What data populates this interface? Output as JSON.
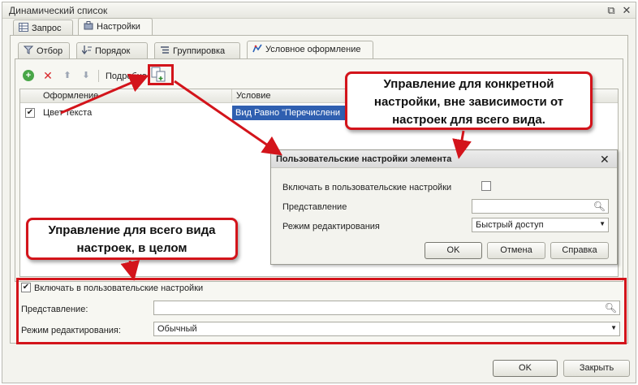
{
  "window": {
    "title": "Динамический список",
    "restore_icon": "restore-icon",
    "close_icon": "close-icon"
  },
  "tabs_top": [
    {
      "label": "Запрос",
      "icon": "table-icon",
      "active": false
    },
    {
      "label": "Настройки",
      "icon": "settings-icon",
      "active": true
    }
  ],
  "tabs_inner": [
    {
      "label": "Отбор",
      "icon": "filter-icon",
      "active": false
    },
    {
      "label": "Порядок",
      "icon": "sort-icon",
      "active": false
    },
    {
      "label": "Группировка",
      "icon": "grouping-icon",
      "active": false
    },
    {
      "label": "Условное оформление",
      "icon": "conditional-format-icon",
      "active": true
    }
  ],
  "toolbar": {
    "more_label": "Подробно"
  },
  "grid": {
    "columns": [
      "Оформление",
      "Условие"
    ],
    "rows": [
      {
        "checked": true,
        "format": "Цвет текста",
        "condition": "Вид Равно \"Перечислени"
      }
    ]
  },
  "popup": {
    "title": "Пользовательские настройки элемента",
    "include_label": "Включать в пользовательские настройки",
    "include_checked": false,
    "presentation_label": "Представление",
    "presentation_value": "",
    "edit_mode_label": "Режим редактирования",
    "edit_mode_value": "Быстрый доступ",
    "ok": "OK",
    "cancel": "Отмена",
    "help": "Справка"
  },
  "bottom": {
    "include_label": "Включать в пользовательские настройки",
    "include_checked": true,
    "presentation_label": "Представление:",
    "presentation_value": "",
    "edit_mode_label": "Режим редактирования:",
    "edit_mode_value": "Обычный"
  },
  "footer": {
    "ok": "OK",
    "close": "Закрыть"
  },
  "callouts": {
    "specific_line1": "Управление для конкретной",
    "specific_line2": "настройки, вне зависимости от",
    "specific_line3": "настроек для всего вида.",
    "whole_line1": "Управление для всего вида",
    "whole_line2": "настроек, в целом"
  },
  "colors": {
    "accent_red": "#d3141b",
    "window_bg": "#f3f3ee"
  }
}
